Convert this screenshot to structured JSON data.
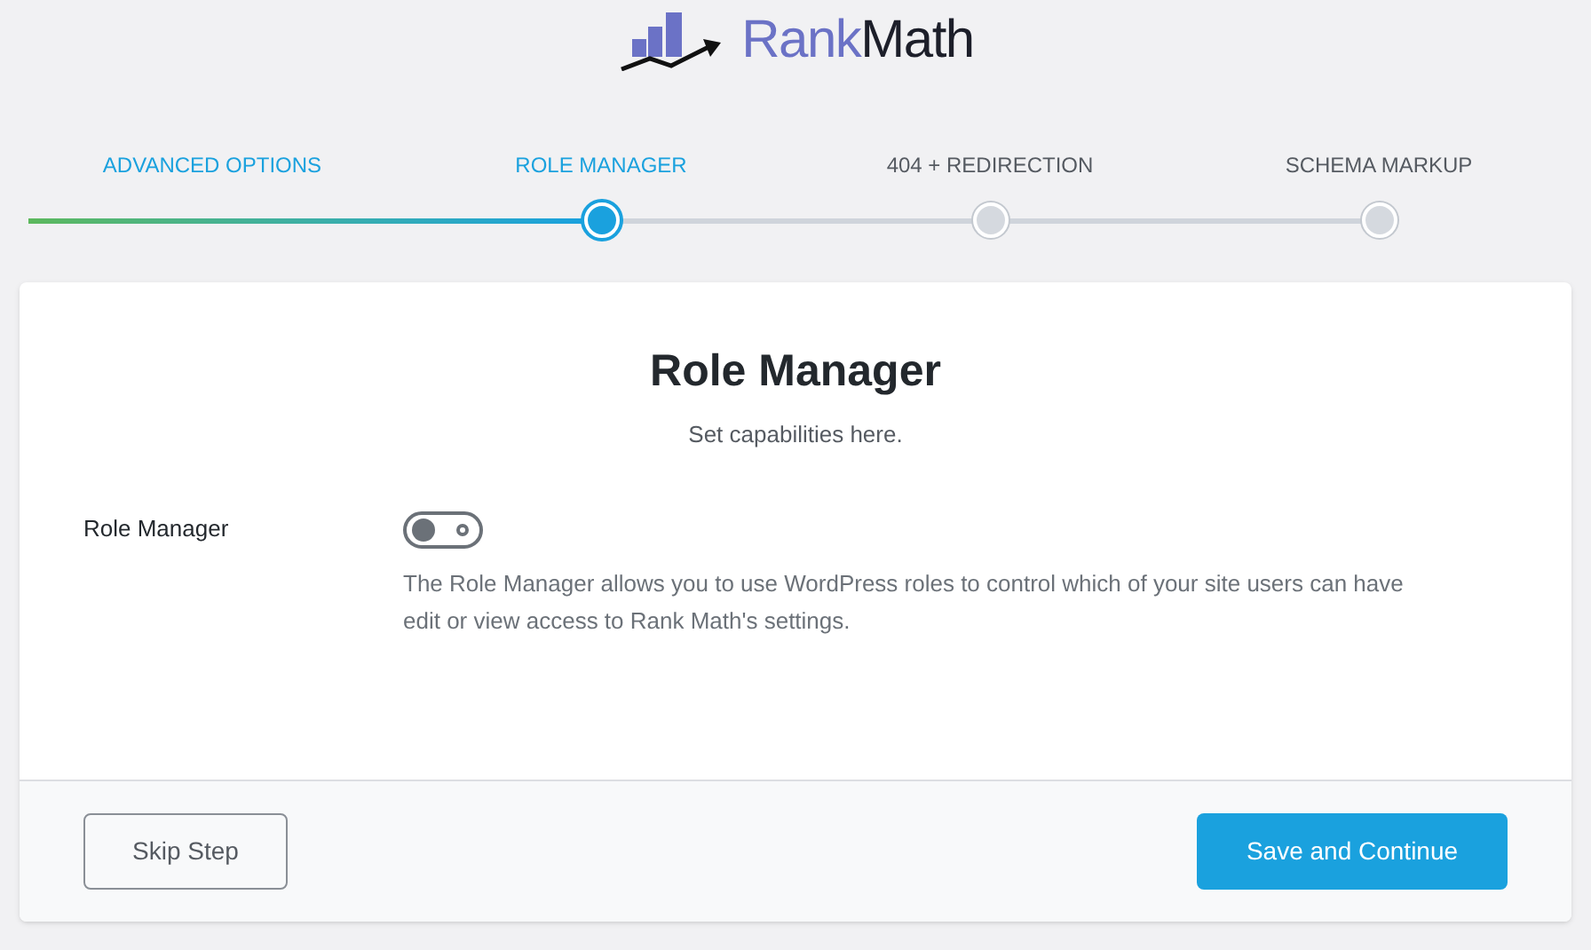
{
  "logo": {
    "part_1": "Rank",
    "part_2": "Math"
  },
  "steps": [
    {
      "label": "ADVANCED OPTIONS",
      "completed": true,
      "selected": false
    },
    {
      "label": "ROLE MANAGER",
      "completed": true,
      "selected": true
    },
    {
      "label": "404 + REDIRECTION",
      "completed": false,
      "selected": false
    },
    {
      "label": "SCHEMA MARKUP",
      "completed": false,
      "selected": false
    }
  ],
  "progress": {
    "level": 0.41
  },
  "card": {
    "title": "Role Manager",
    "subtitle": "Set capabilities here.",
    "setting": {
      "label": "Role Manager",
      "on": false,
      "description": "The Role Manager allows you to use WordPress roles to control which of your site users can have edit or view access to Rank Math's settings."
    },
    "skip_button": "Skip Step",
    "save_button": "Save and Continue"
  }
}
